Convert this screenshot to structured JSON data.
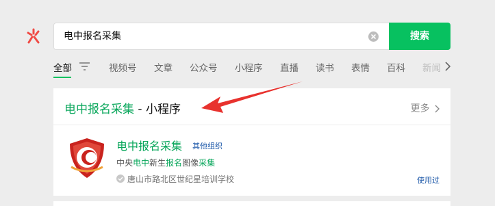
{
  "search": {
    "query": "电中报名采集",
    "button_label": "搜索"
  },
  "tabs": [
    {
      "label": "全部",
      "active": true
    },
    {
      "label": "视频号"
    },
    {
      "label": "文章"
    },
    {
      "label": "公众号"
    },
    {
      "label": "小程序"
    },
    {
      "label": "直播"
    },
    {
      "label": "读书"
    },
    {
      "label": "表情"
    },
    {
      "label": "百科"
    },
    {
      "label": "新闻"
    }
  ],
  "section": {
    "title_highlight": "电中报名采集",
    "title_rest": " - 小程序",
    "more_label": "更多"
  },
  "result": {
    "name": "电中报名采集",
    "tag": "其他组织",
    "desc_parts": [
      {
        "text": "中央",
        "hl": false
      },
      {
        "text": "电中",
        "hl": true
      },
      {
        "text": "新生",
        "hl": false
      },
      {
        "text": "报名",
        "hl": true
      },
      {
        "text": "图像",
        "hl": false
      },
      {
        "text": "采集",
        "hl": true
      }
    ],
    "org": "唐山市路北区世纪星培训学校",
    "used_label": "使用过"
  },
  "colors": {
    "accent": "#07c160",
    "highlight": "#07a65a",
    "link": "#1a56a8",
    "annotation": "#e8322e"
  }
}
